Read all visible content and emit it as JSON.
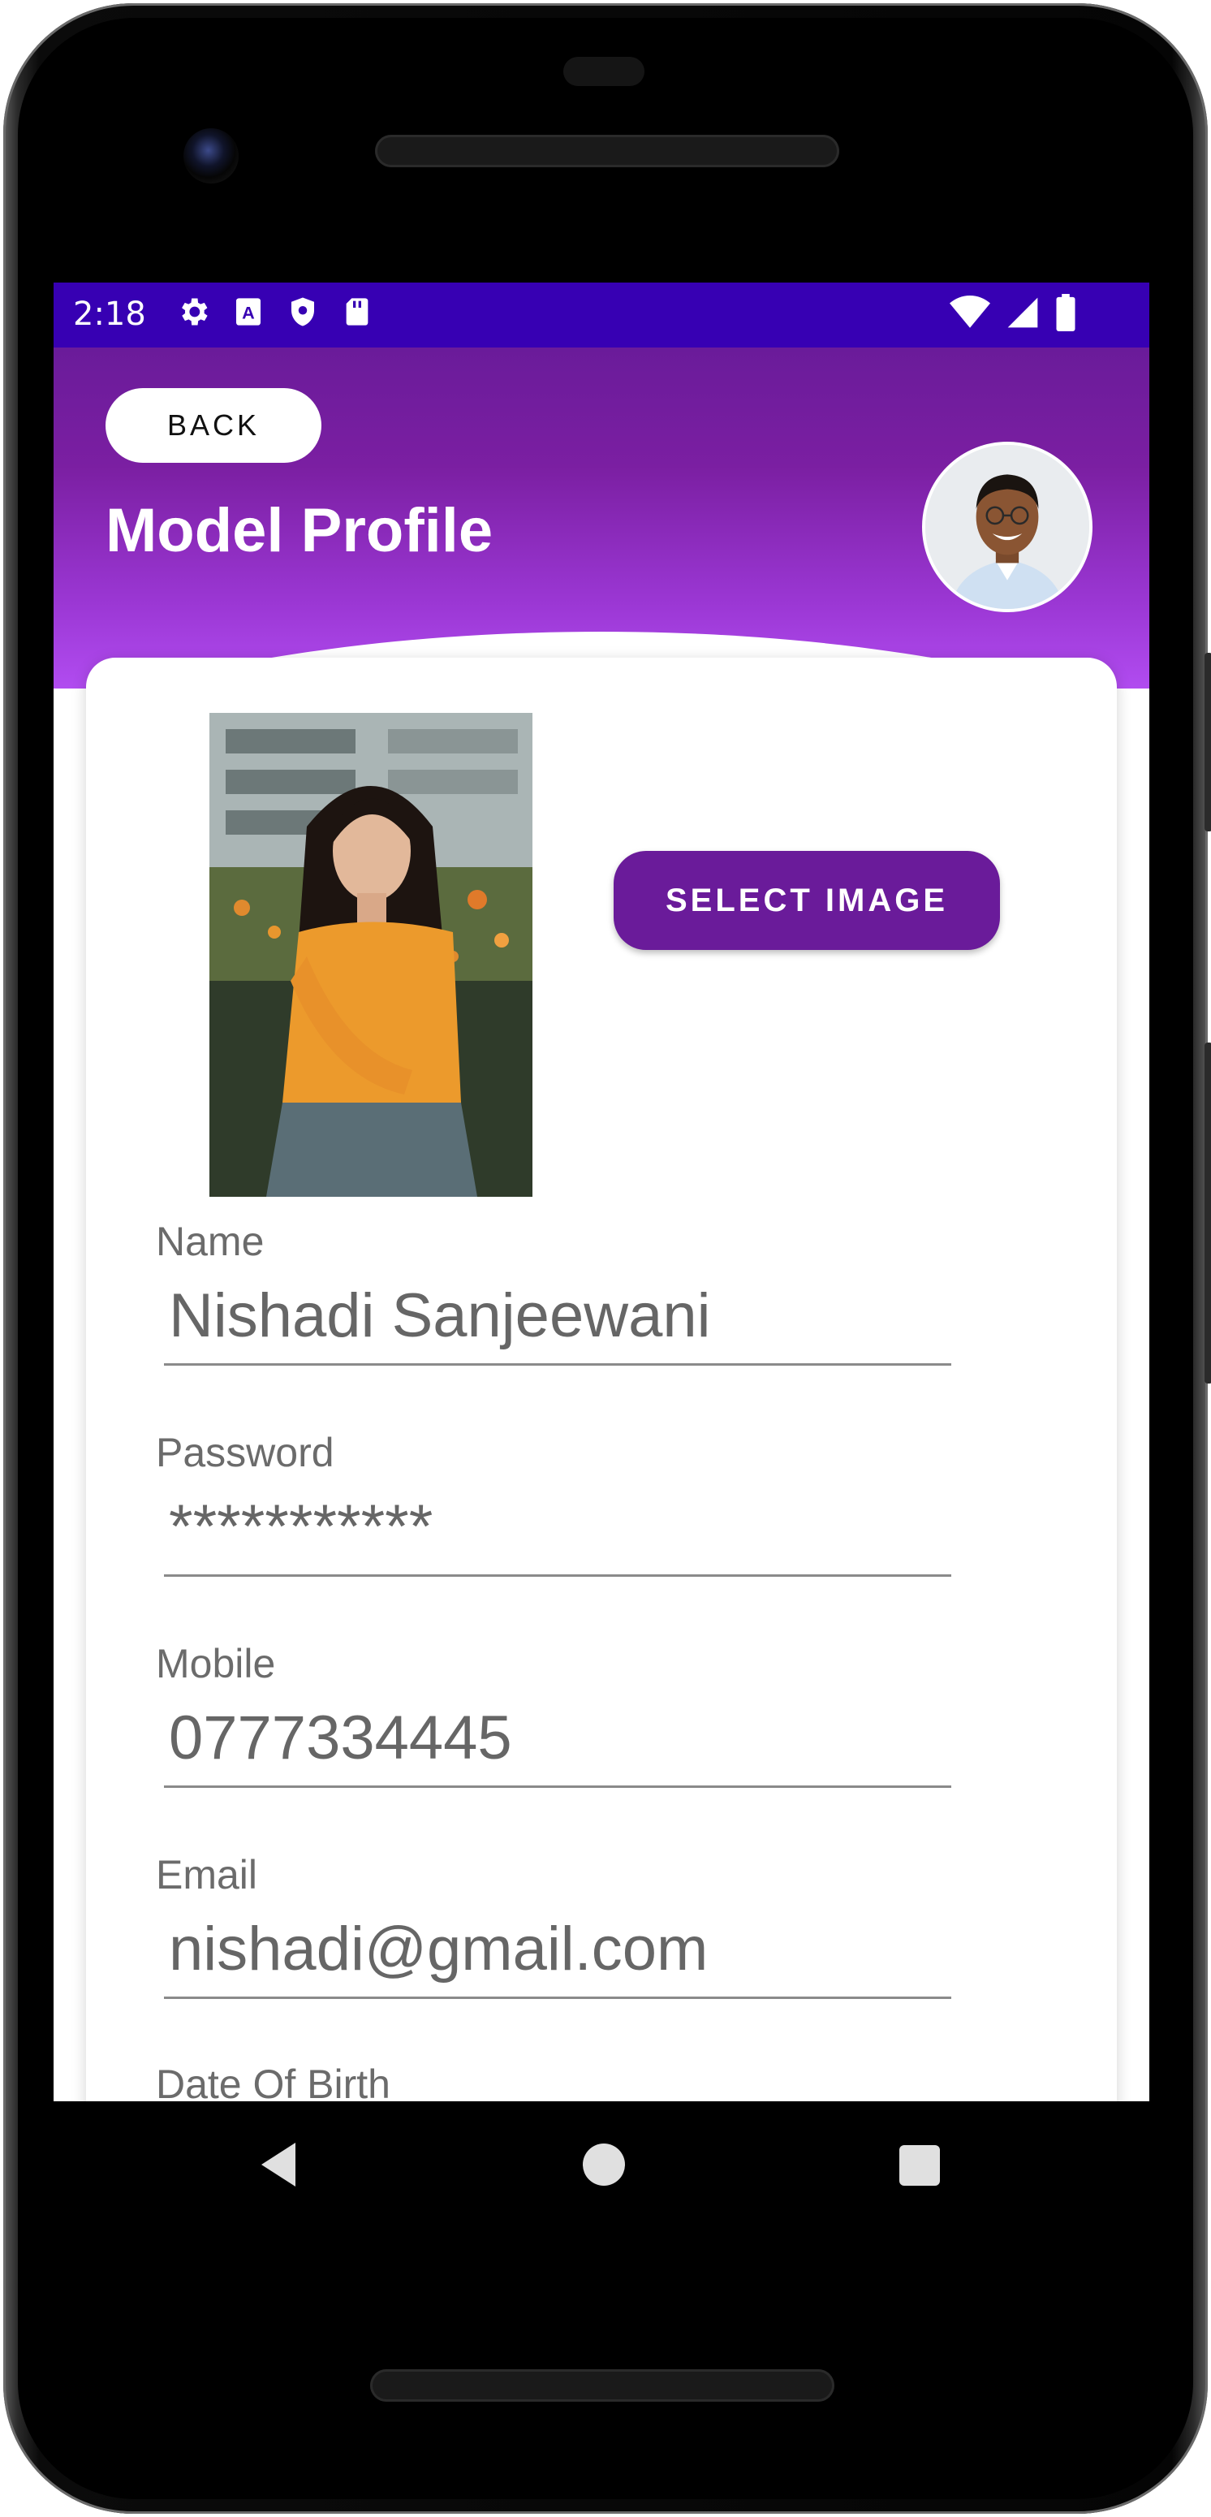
{
  "status_bar": {
    "time": "2:18",
    "left_icons": [
      "gear-icon",
      "a-icon",
      "shield-icon",
      "sd-card-icon"
    ],
    "right_icons": [
      "wifi-icon",
      "signal-icon",
      "battery-icon"
    ],
    "color": "#3700b3"
  },
  "header": {
    "back_label": "BACK",
    "title": "Model Profile",
    "gradient_colors": [
      "#6a1b9a",
      "#b14cf0"
    ]
  },
  "card": {
    "select_image_label": "SELECT IMAGE",
    "accent": "#6a1b9a"
  },
  "form": {
    "name": {
      "label": "Name",
      "value": "Nishadi Sanjeewani"
    },
    "password": {
      "label": "Password",
      "value": "***********"
    },
    "mobile": {
      "label": "Mobile",
      "value": "0777334445"
    },
    "email": {
      "label": "Email",
      "value": "nishadi@gmail.com"
    },
    "dob": {
      "label": "Date Of Birth"
    }
  },
  "nav_bar": {
    "icons": [
      "nav-back-icon",
      "nav-home-icon",
      "nav-recents-icon"
    ]
  }
}
